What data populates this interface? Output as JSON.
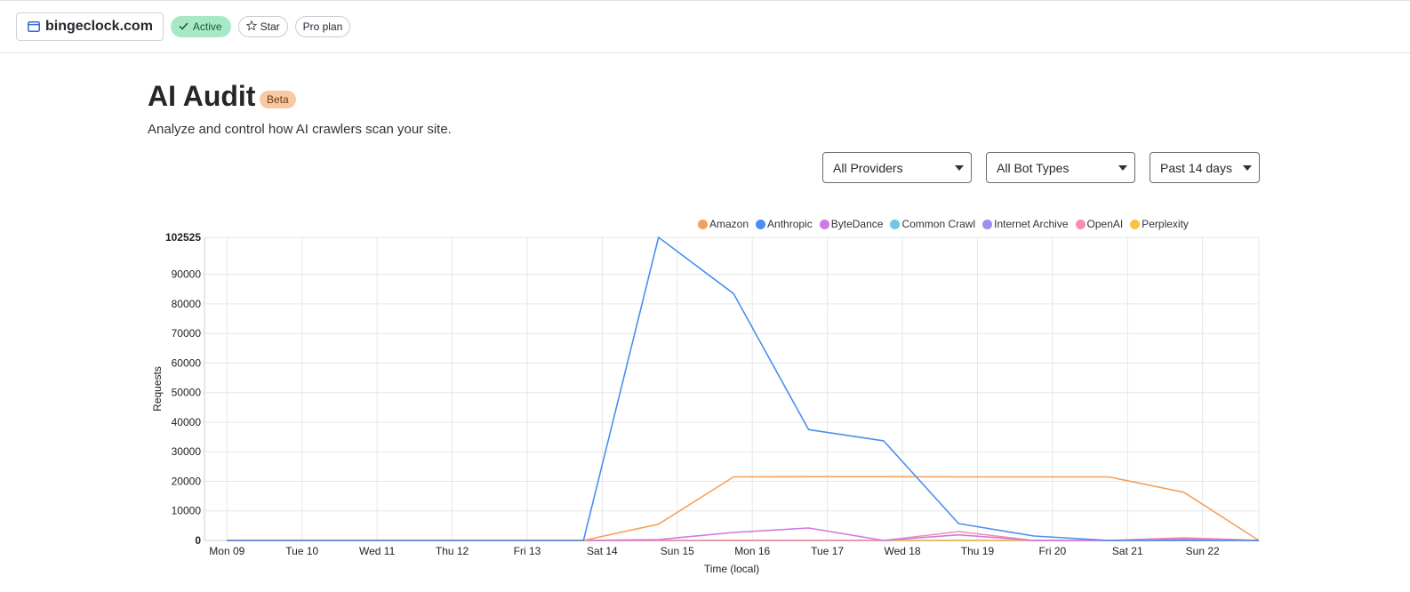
{
  "topbar": {
    "site": "bingeclock.com",
    "status": "Active",
    "star_label": "Star",
    "plan": "Pro plan"
  },
  "header": {
    "title": "AI Audit",
    "badge": "Beta",
    "subtitle": "Analyze and control how AI crawlers scan your site."
  },
  "filters": {
    "provider": "All Providers",
    "bot_type": "All Bot Types",
    "range": "Past 14 days"
  },
  "colors": {
    "active_bg": "#a8e8c4",
    "beta_bg": "#f8c9a0"
  },
  "chart_data": {
    "type": "line",
    "xlabel": "Time (local)",
    "ylabel": "Requests",
    "ylim": [
      0,
      102525
    ],
    "yticks": [
      0,
      10000,
      20000,
      30000,
      40000,
      50000,
      60000,
      70000,
      80000,
      90000,
      102525
    ],
    "categories": [
      "Mon 09",
      "Tue 10",
      "Wed 11",
      "Thu 12",
      "Fri 13",
      "Sat 14",
      "Sun 15",
      "Mon 16",
      "Tue 17",
      "Wed 18",
      "Thu 19",
      "Fri 20",
      "Sat 21",
      "Sun 22"
    ],
    "grid": true,
    "legend_position": "top-right",
    "x_points": [
      0,
      1,
      2,
      3,
      4,
      4.75,
      5.75,
      6.75,
      7.75,
      8.75,
      9.75,
      10.75,
      11.75,
      12.75,
      13.75
    ],
    "series": [
      {
        "name": "Amazon",
        "color": "#f5a05a",
        "values": [
          0,
          0,
          0,
          0,
          0,
          0,
          5500,
          21500,
          21600,
          21600,
          21500,
          21500,
          21500,
          16300,
          0
        ]
      },
      {
        "name": "Anthropic",
        "color": "#4a8ff0",
        "values": [
          0,
          0,
          0,
          0,
          0,
          0,
          102525,
          83500,
          37500,
          33700,
          5700,
          1500,
          0,
          0,
          0
        ]
      },
      {
        "name": "ByteDance",
        "color": "#cf79e3",
        "values": [
          0,
          0,
          0,
          0,
          0,
          0,
          300,
          2700,
          4200,
          0,
          1900,
          0,
          0,
          500,
          0
        ]
      },
      {
        "name": "Common Crawl",
        "color": "#6cc9e0",
        "values": [
          0,
          0,
          0,
          0,
          0,
          0,
          0,
          0,
          0,
          0,
          0,
          0,
          0,
          0,
          0
        ]
      },
      {
        "name": "Internet Archive",
        "color": "#9b8ef0",
        "values": [
          0,
          0,
          0,
          0,
          0,
          0,
          0,
          0,
          0,
          0,
          0,
          0,
          0,
          0,
          0
        ]
      },
      {
        "name": "OpenAI",
        "color": "#f48fb1",
        "values": [
          0,
          0,
          0,
          0,
          0,
          0,
          0,
          0,
          0,
          0,
          3000,
          0,
          0,
          900,
          0
        ]
      },
      {
        "name": "Perplexity",
        "color": "#f6c343",
        "values": [
          0,
          0,
          0,
          0,
          0,
          0,
          0,
          0,
          0,
          0,
          0,
          0,
          0,
          0,
          0
        ]
      }
    ]
  }
}
